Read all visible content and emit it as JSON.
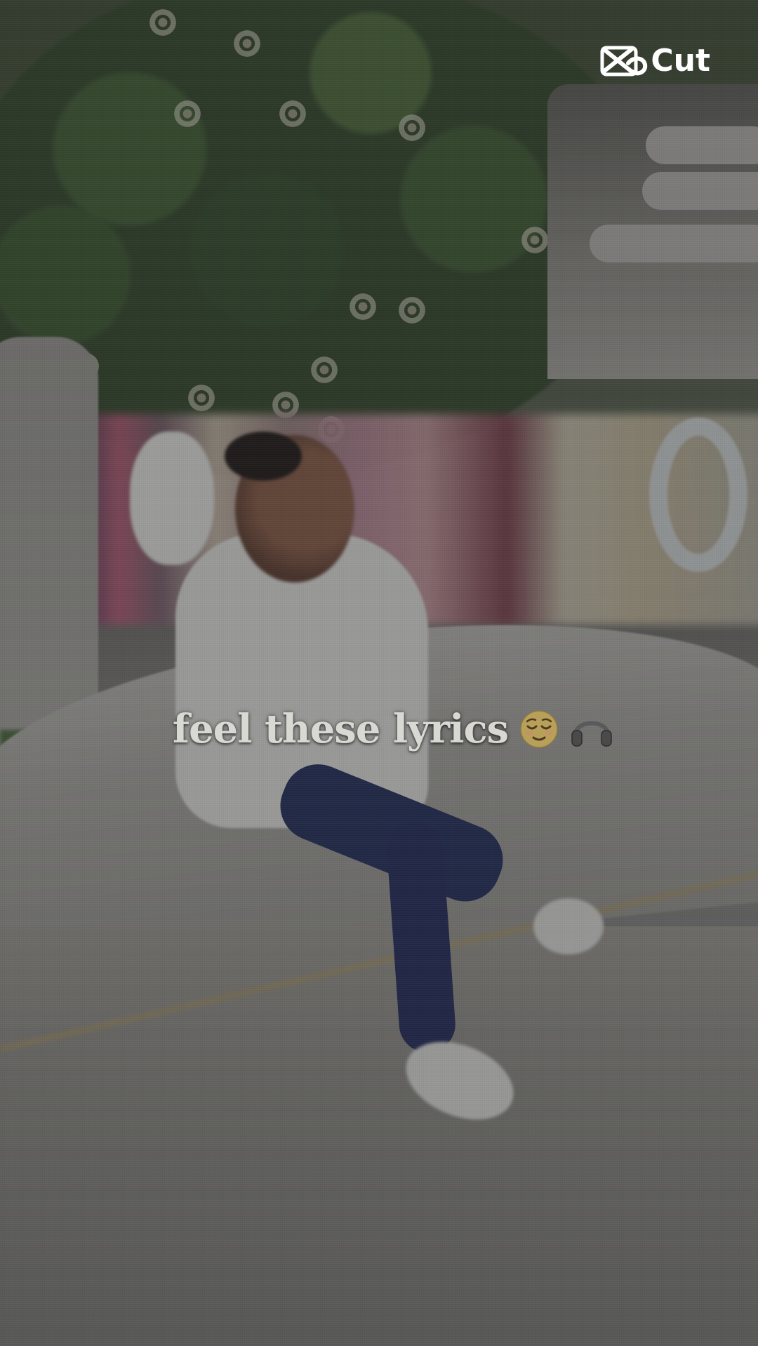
{
  "watermark": {
    "text": "Cut",
    "icon": "capcut-logo-icon"
  },
  "caption": {
    "text": "feel these lyrics",
    "emojis": [
      "relieved-face-icon",
      "headphones-icon"
    ]
  },
  "colors": {
    "caption_text": "#d9d9d4",
    "watermark": "#ffffff",
    "overlay": "rgba(40,40,40,0.42)"
  }
}
